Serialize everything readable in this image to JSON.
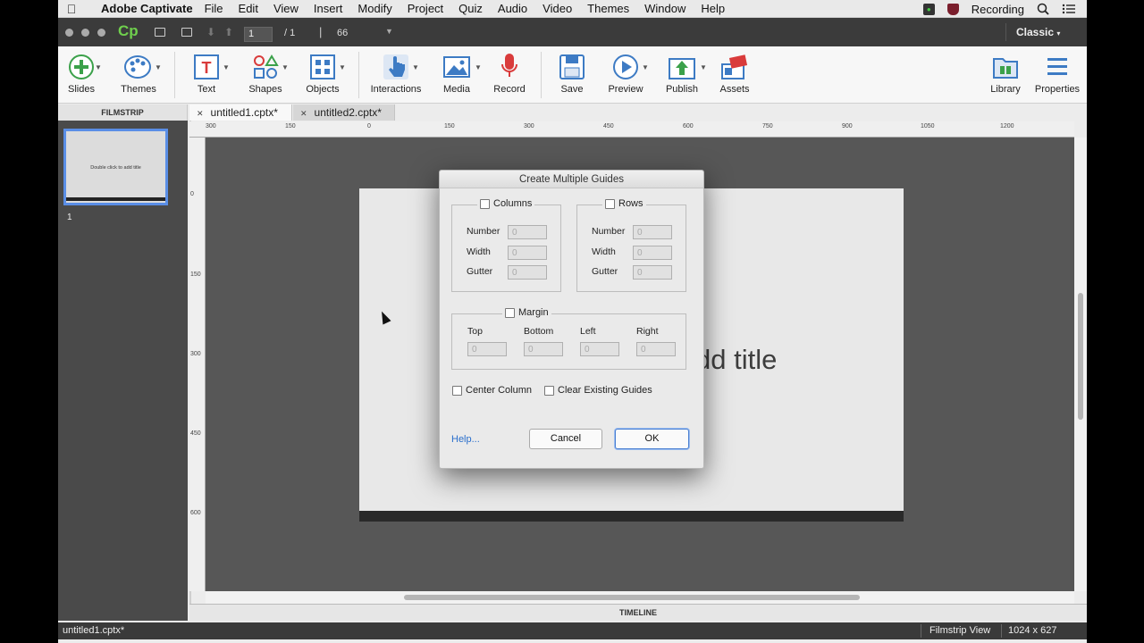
{
  "menubar": {
    "app_name": "Adobe Captivate",
    "items": [
      "File",
      "Edit",
      "View",
      "Insert",
      "Modify",
      "Project",
      "Quiz",
      "Audio",
      "Video",
      "Themes",
      "Window",
      "Help"
    ],
    "recording_label": "Recording"
  },
  "titlebar": {
    "logo": "Cp",
    "current_slide": "1",
    "total_slides": "/ 1",
    "separator": "|",
    "zoom": "66",
    "workspace": "Classic"
  },
  "toolbar": {
    "slides": "Slides",
    "themes": "Themes",
    "text": "Text",
    "shapes": "Shapes",
    "objects": "Objects",
    "interactions": "Interactions",
    "media": "Media",
    "record": "Record",
    "save": "Save",
    "preview": "Preview",
    "publish": "Publish",
    "assets": "Assets",
    "library": "Library",
    "properties": "Properties"
  },
  "filmstrip": {
    "header": "FILMSTRIP",
    "thumb_text": "Double click to add title",
    "slide_number": "1"
  },
  "tabs": [
    "untitled1.cptx*",
    "untitled2.cptx*"
  ],
  "ruler": {
    "top": [
      "300",
      "150",
      "0",
      "150",
      "300",
      "450",
      "600",
      "750",
      "900",
      "1050",
      "1200"
    ],
    "left": [
      "0",
      "150",
      "300",
      "450",
      "600"
    ]
  },
  "slide": {
    "title_text": "dd title"
  },
  "timeline_label": "TIMELINE",
  "statusbar": {
    "file": "untitled1.cptx*",
    "view": "Filmstrip View",
    "size": "1024 x 627"
  },
  "dialog": {
    "title": "Create Multiple Guides",
    "columns": {
      "label": "Columns",
      "number_label": "Number",
      "number_value": "0",
      "width_label": "Width",
      "width_value": "0",
      "gutter_label": "Gutter",
      "gutter_value": "0"
    },
    "rows": {
      "label": "Rows",
      "number_label": "Number",
      "number_value": "0",
      "width_label": "Width",
      "width_value": "0",
      "gutter_label": "Gutter",
      "gutter_value": "0"
    },
    "margin": {
      "label": "Margin",
      "top_label": "Top",
      "top_value": "0",
      "bottom_label": "Bottom",
      "bottom_value": "0",
      "left_label": "Left",
      "left_value": "0",
      "right_label": "Right",
      "right_value": "0"
    },
    "center_column": "Center Column",
    "clear_guides": "Clear Existing Guides",
    "help": "Help...",
    "cancel": "Cancel",
    "ok": "OK"
  }
}
